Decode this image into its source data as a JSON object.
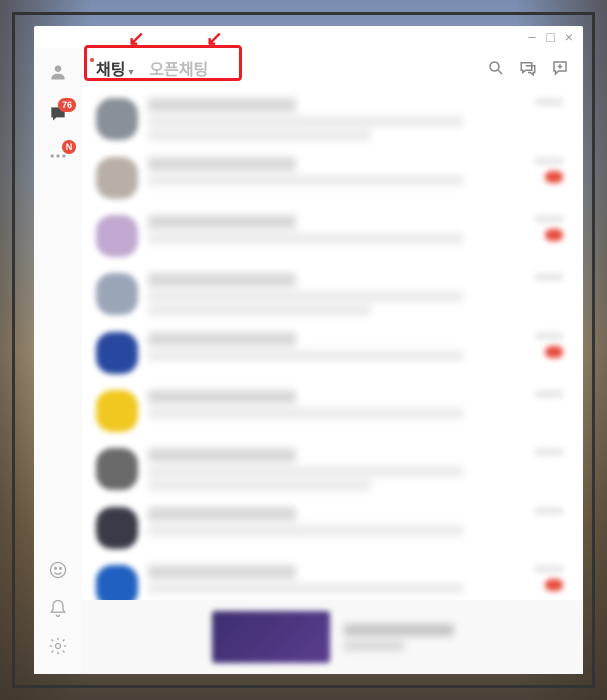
{
  "tabs": {
    "chat": "채팅",
    "openchat": "오픈채팅"
  },
  "sidebar": {
    "chat_badge": "76",
    "more_badge": "N"
  },
  "window_controls": {
    "min": "−",
    "max": "□",
    "close": "×"
  },
  "avatar_colors": [
    "#8a9098",
    "#b8b0a8",
    "#c0a8d0",
    "#9aa5b8",
    "#2848a0",
    "#f0c820",
    "#6a6a6a",
    "#3a3a48",
    "#2060c0"
  ],
  "unread_indices": [
    1,
    2,
    4,
    8
  ]
}
